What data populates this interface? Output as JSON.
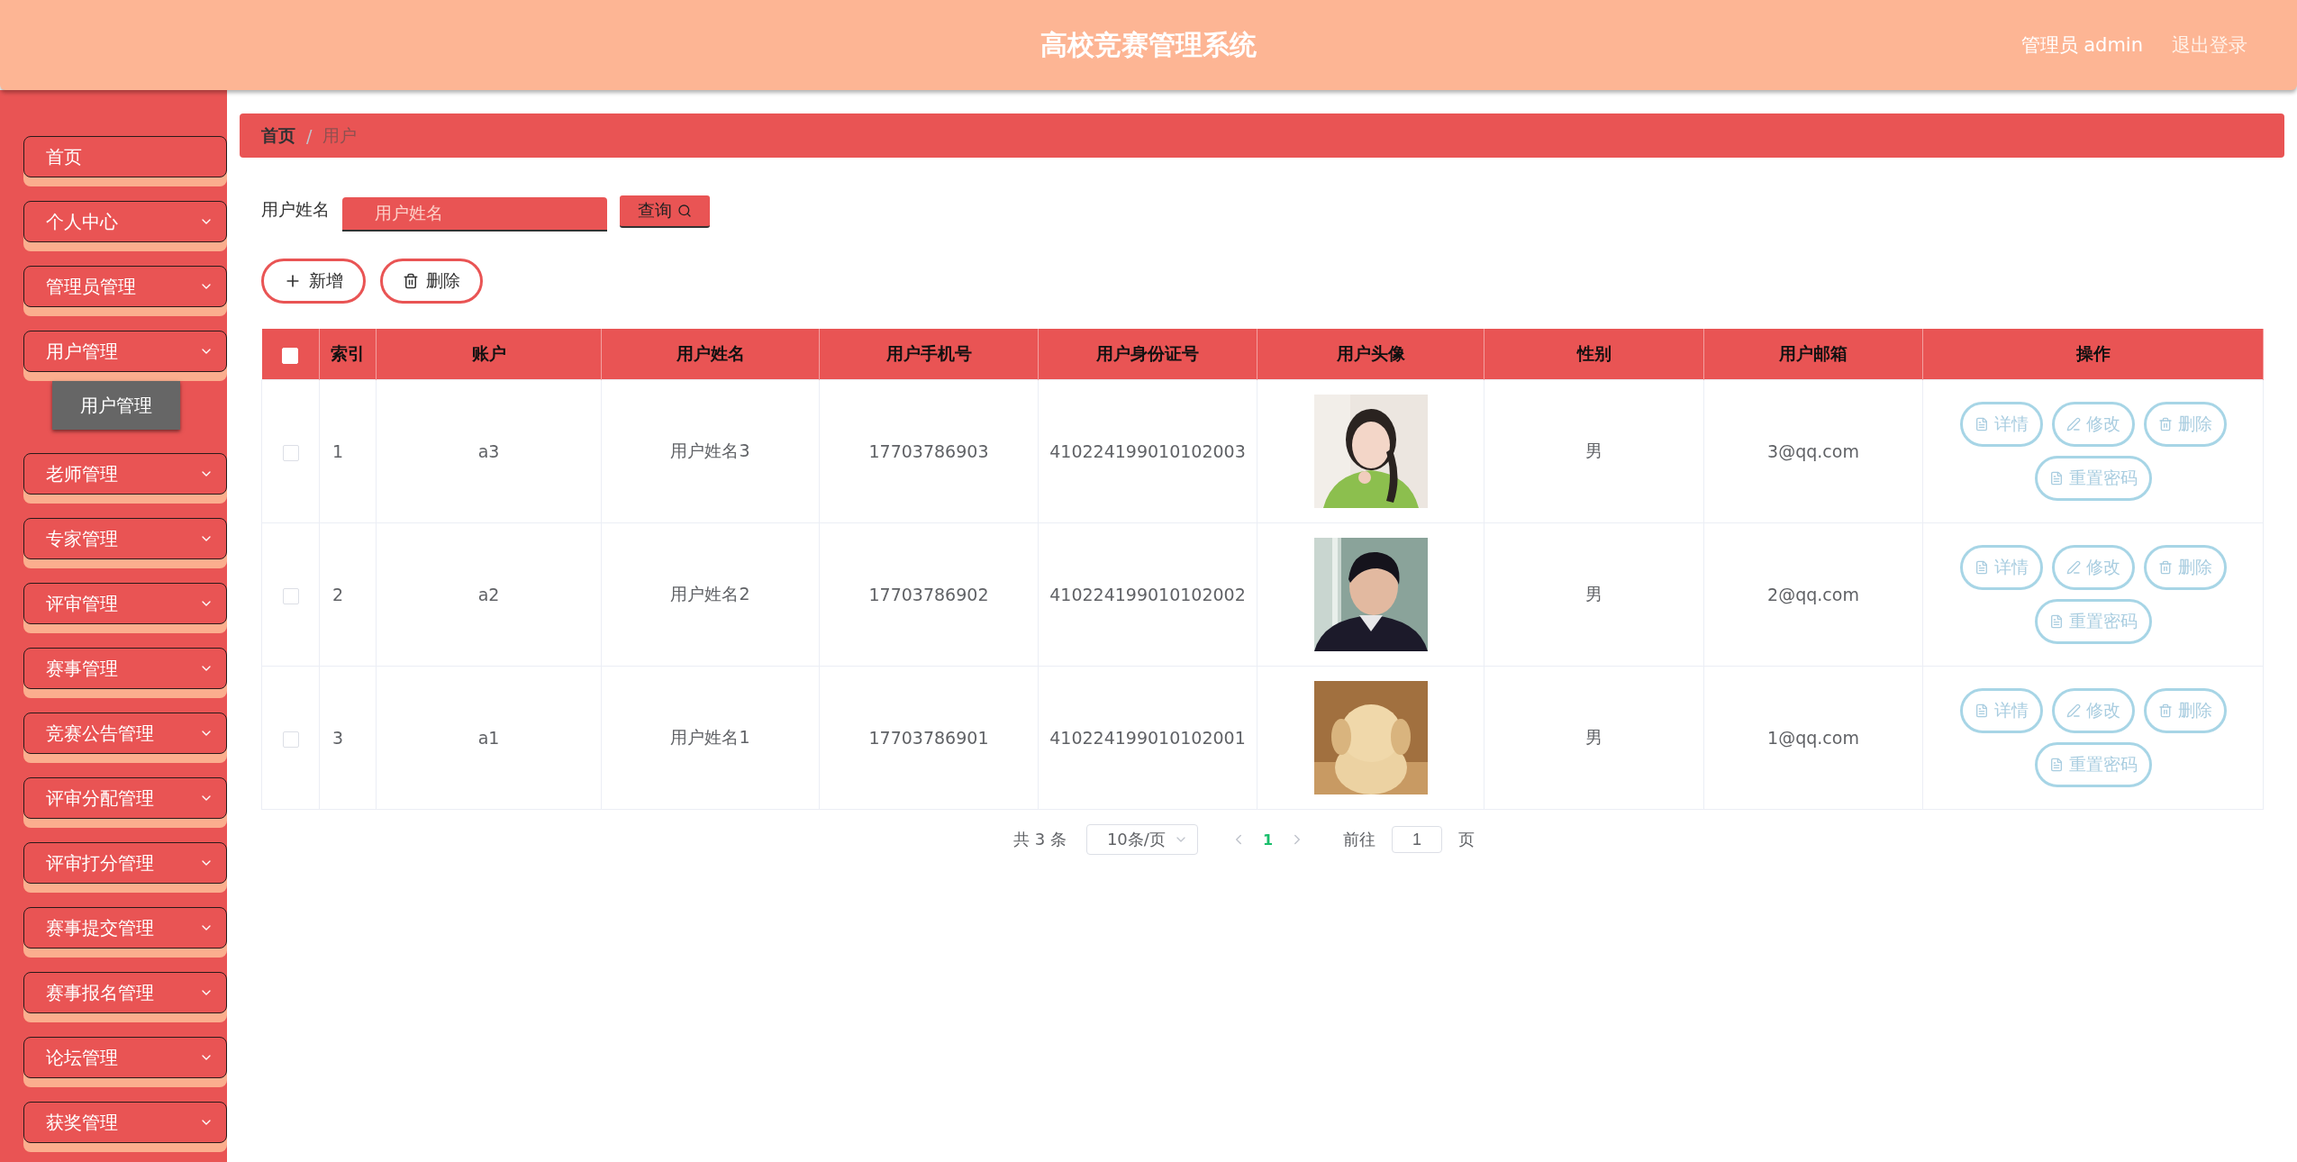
{
  "header": {
    "title": "高校竞赛管理系统",
    "user": "管理员 admin",
    "logout": "退出登录"
  },
  "sidebar": {
    "items": [
      {
        "label": "首页",
        "kind": "link"
      },
      {
        "label": "个人中心",
        "kind": "submenu"
      },
      {
        "label": "管理员管理",
        "kind": "submenu"
      },
      {
        "label": "用户管理",
        "kind": "submenu",
        "children": [
          {
            "label": "用户管理",
            "selected": true
          }
        ]
      },
      {
        "label": "老师管理",
        "kind": "submenu"
      },
      {
        "label": "专家管理",
        "kind": "submenu"
      },
      {
        "label": "评审管理",
        "kind": "submenu"
      },
      {
        "label": "赛事管理",
        "kind": "submenu"
      },
      {
        "label": "竞赛公告管理",
        "kind": "submenu"
      },
      {
        "label": "评审分配管理",
        "kind": "submenu"
      },
      {
        "label": "评审打分管理",
        "kind": "submenu"
      },
      {
        "label": "赛事提交管理",
        "kind": "submenu"
      },
      {
        "label": "赛事报名管理",
        "kind": "submenu"
      },
      {
        "label": "论坛管理",
        "kind": "submenu"
      },
      {
        "label": "获奖管理",
        "kind": "submenu"
      }
    ]
  },
  "breadcrumb": {
    "items": [
      "首页",
      "用户"
    ],
    "separator": "/"
  },
  "search": {
    "label": "用户姓名",
    "placeholder": "用户姓名",
    "button": "查询"
  },
  "actions": [
    {
      "label": "新增",
      "kind": "add"
    },
    {
      "label": "删除",
      "kind": "delete"
    }
  ],
  "table": {
    "select_all": {
      "checked": false
    },
    "columns": [
      "索引",
      "账户",
      "用户姓名",
      "用户手机号",
      "用户身份证号",
      "用户头像",
      "性别",
      "用户邮箱",
      "操作"
    ],
    "rows": [
      {
        "checked": false,
        "index": "1",
        "account": "a3",
        "name": "用户姓名3",
        "phone": "17703786903",
        "id_number": "410224199010102003",
        "gender": "男",
        "email": "3@qq.com",
        "buttons": [
          {
            "label": "详情",
            "kind": "detail"
          },
          {
            "label": "修改",
            "kind": "edit"
          },
          {
            "label": "删除",
            "kind": "delete"
          },
          {
            "label": "重置密码",
            "kind": "detail"
          }
        ]
      },
      {
        "checked": false,
        "index": "2",
        "account": "a2",
        "name": "用户姓名2",
        "phone": "17703786902",
        "id_number": "410224199010102002",
        "gender": "男",
        "email": "2@qq.com",
        "buttons": [
          {
            "label": "详情",
            "kind": "detail"
          },
          {
            "label": "修改",
            "kind": "edit"
          },
          {
            "label": "删除",
            "kind": "delete"
          },
          {
            "label": "重置密码",
            "kind": "detail"
          }
        ]
      },
      {
        "checked": false,
        "index": "3",
        "account": "a1",
        "name": "用户姓名1",
        "phone": "17703786901",
        "id_number": "410224199010102001",
        "gender": "男",
        "email": "1@qq.com",
        "buttons": [
          {
            "label": "详情",
            "kind": "detail"
          },
          {
            "label": "修改",
            "kind": "edit"
          },
          {
            "label": "删除",
            "kind": "delete"
          },
          {
            "label": "重置密码",
            "kind": "detail"
          }
        ]
      }
    ]
  },
  "pagination": {
    "total": "共 3 条",
    "page_size": "10条/页",
    "pages": [
      {
        "label": "1",
        "selected": true
      }
    ],
    "goto_label": "前往",
    "goto_value": "1",
    "goto_suffix": "页"
  }
}
